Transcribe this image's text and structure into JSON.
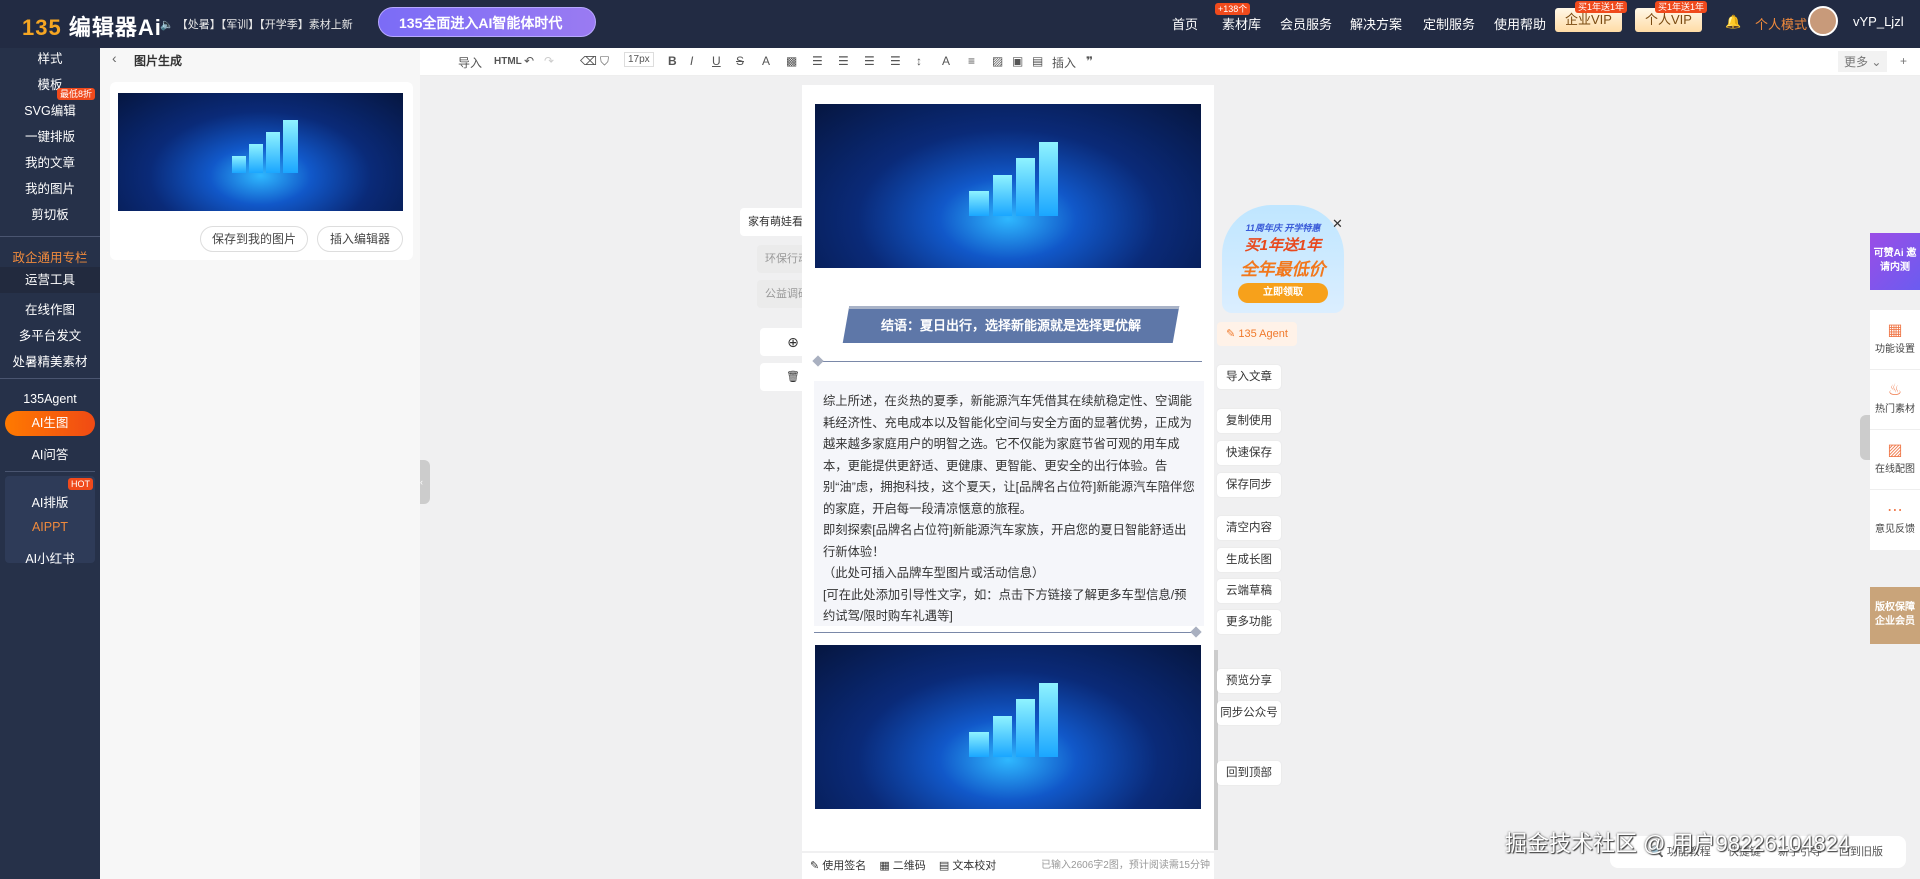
{
  "topbar": {
    "logo_num": "135",
    "logo_text": "编辑器Ai",
    "notice": "【处暑】【军训】【开学季】素材上新",
    "ai_banner": "135全面进入AI智能体时代",
    "nav": [
      "首页",
      "素材库",
      "会员服务",
      "解决方案",
      "定制服务",
      "使用帮助"
    ],
    "nav_badge": "+138个",
    "enterprise_vip": "企业VIP",
    "personal_vip": "个人VIP",
    "vip_badge": "买1年送1年",
    "mode": "个人模式",
    "username": "vYP_Ljzl"
  },
  "sidebar": {
    "items": [
      "样式",
      "模板",
      "SVG编辑",
      "一键排版",
      "我的文章",
      "我的图片",
      "剪切板"
    ],
    "svg_badge": "最低8折",
    "group2": [
      "政企通用专栏",
      "运营工具",
      "在线作图",
      "多平台发文",
      "处暑精美素材"
    ],
    "group3": [
      "135Agent",
      "AI生图",
      "AI问答"
    ],
    "group4": [
      "AI排版",
      "AIPPT",
      "AI小红书"
    ],
    "hot": "HOT"
  },
  "panel": {
    "title": "图片生成",
    "save_btn": "保存到我的图片",
    "insert_btn": "插入编辑器"
  },
  "toolbar": {
    "import": "导入",
    "html": "HTML",
    "font_size": "17px",
    "insert": "插入",
    "more": "更多"
  },
  "float_tabs": [
    "家有萌娃看",
    "环保行动",
    "公益调研"
  ],
  "article": {
    "heading": "结语：夏日出行，选择新能源就是选择更优解",
    "paragraphs": [
      "综上所述，在炎热的夏季，新能源汽车凭借其在续航稳定性、空调能耗经济性、充电成本以及智能化空间与安全方面的显著优势，正成为越来越多家庭用户的明智之选。它不仅能为家庭节省可观的用车成本，更能提供更舒适、更健康、更智能、更安全的出行体验。告别“油”虑，拥抱科技，这个夏天，让[品牌名占位符]新能源汽车陪伴您的家庭，开启每一段清凉惬意的旅程。",
      "即刻探索[品牌名占位符]新能源汽车家族，开启您的夏日智能舒适出行新体验！",
      "（此处可插入品牌车型图片或活动信息）",
      "[可在此处添加引导性文字，如：点击下方链接了解更多车型信息/预约试驾/限时购车礼遇等]"
    ]
  },
  "status": {
    "signature": "使用签名",
    "qrcode": "二维码",
    "proofread": "文本校对",
    "count": "已输入2606字2图，预计阅读需15分钟"
  },
  "promo": {
    "line1": "11周年庆 开学特惠",
    "line2": "买1年送1年",
    "line3": "全年最低价",
    "cta": "立即领取"
  },
  "agent_btn": "135 Agent",
  "right_buttons": [
    "导入文章",
    "复制使用",
    "快速保存",
    "保存同步",
    "清空内容",
    "生成长图",
    "云端草稿",
    "更多功能",
    "预览分享",
    "同步公众号",
    "回到顶部"
  ],
  "rail": {
    "invite": "可赞Ai 邀请内测",
    "items": [
      "功能设置",
      "热门素材",
      "在线配图",
      "意见反馈"
    ],
    "copyright": "版权保障 企业会员"
  },
  "footer_links": [
    "功能教程",
    "快捷键",
    "新手引导",
    "回到旧版"
  ],
  "watermark": "掘金技术社区 @ 用户98226104824"
}
